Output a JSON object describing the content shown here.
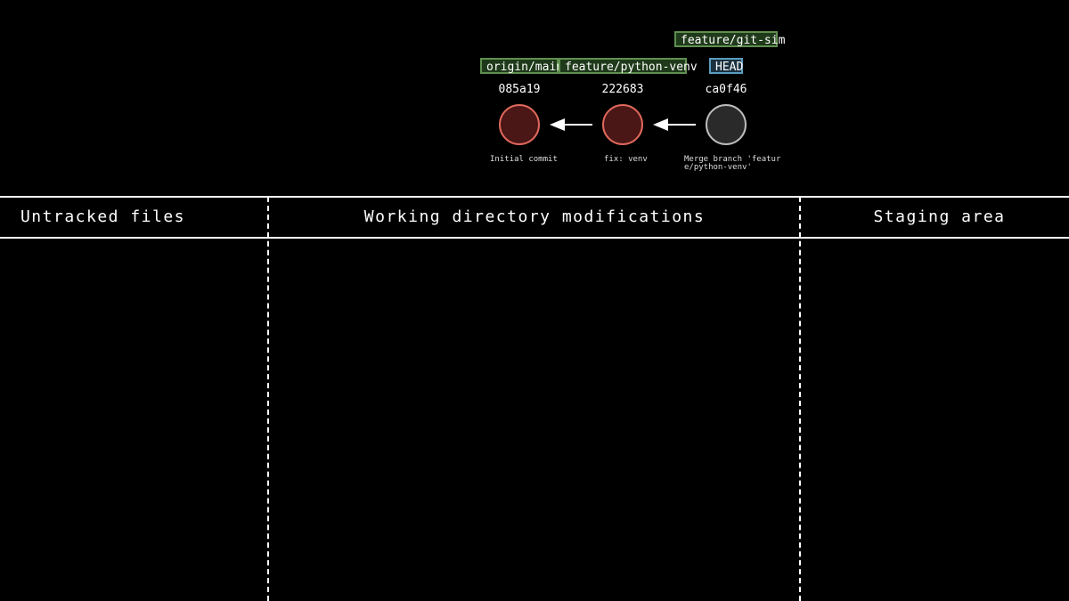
{
  "graph": {
    "labels": {
      "origin_main": "origin/main",
      "feature_python_venv": "feature/python-venv",
      "feature_git_sim": "feature/git-sim",
      "head": "HEAD"
    },
    "commits": [
      {
        "sha": "085a19",
        "message": "Initial commit",
        "color": "#e0685c"
      },
      {
        "sha": "222683",
        "message": "fix: venv",
        "color": "#e0685c"
      },
      {
        "sha": "ca0f46",
        "message": "Merge branch 'featur\ne/python-venv'",
        "color": "#bdbdbd"
      }
    ]
  },
  "columns": {
    "untracked": {
      "title": "Untracked files"
    },
    "working": {
      "title": "Working directory modifications"
    },
    "staging": {
      "title": "Staging area"
    }
  }
}
